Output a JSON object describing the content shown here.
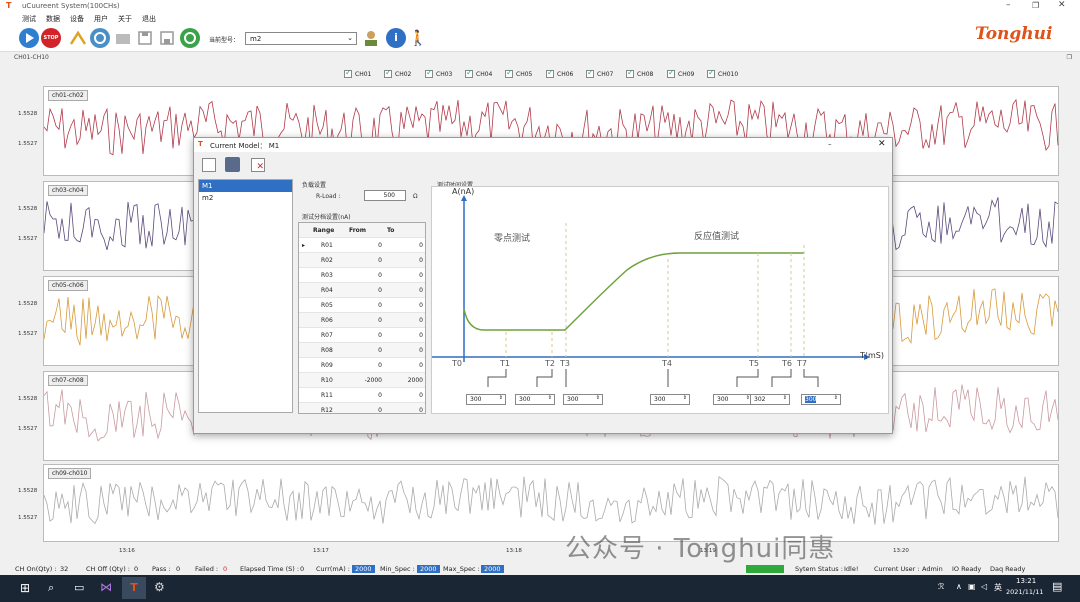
{
  "window": {
    "title": "uCuureent System(100CHs)"
  },
  "menu": [
    "测试",
    "数据",
    "设备",
    "用户",
    "关于",
    "退出"
  ],
  "toolbar": {
    "model_label": "当前型号：",
    "model_value": "m2",
    "stop_label": "STOP"
  },
  "brand": "Tonghui",
  "main_header": "CH01-CH10",
  "channels": [
    "CH01",
    "CH02",
    "CH03",
    "CH04",
    "CH05",
    "CH06",
    "CH07",
    "CH08",
    "CH09",
    "CH010"
  ],
  "panels": [
    {
      "label": "ch01-ch02",
      "color": "#b03a4a",
      "y_ticks": [
        "1.5528",
        "1.5527"
      ]
    },
    {
      "label": "ch03-ch04",
      "color": "#5a4a7a",
      "y_ticks": [
        "1.5528",
        "1.5527"
      ]
    },
    {
      "label": "ch05-ch06",
      "color": "#d79a3a",
      "y_ticks": [
        "1.5528",
        "1.5527"
      ]
    },
    {
      "label": "ch07-ch08",
      "color": "#c89aa0",
      "y_ticks": [
        "1.5528",
        "1.5527"
      ]
    },
    {
      "label": "ch09-ch010",
      "color": "#aaaaaa",
      "y_ticks": [
        "1.5528",
        "1.5527"
      ]
    }
  ],
  "x_ticks": [
    "13:16",
    "13:17",
    "13:18",
    "13:19",
    "13:20"
  ],
  "dialog": {
    "title": "Current Model： M1",
    "models": [
      "M1",
      "m2"
    ],
    "load_group": "负载设置",
    "rload_label": "R-Load :",
    "rload_value": "500",
    "rload_unit": "Ω",
    "range_group": "测试分档设置(nA)",
    "table_headers": [
      "Range",
      "From",
      "To"
    ],
    "rows": [
      [
        "R01",
        "0",
        "0"
      ],
      [
        "R02",
        "0",
        "0"
      ],
      [
        "R03",
        "0",
        "0"
      ],
      [
        "R04",
        "0",
        "0"
      ],
      [
        "R05",
        "0",
        "0"
      ],
      [
        "R06",
        "0",
        "0"
      ],
      [
        "R07",
        "0",
        "0"
      ],
      [
        "R08",
        "0",
        "0"
      ],
      [
        "R09",
        "0",
        "0"
      ],
      [
        "R10",
        "-2000",
        "2000"
      ],
      [
        "R11",
        "0",
        "0"
      ],
      [
        "R12",
        "0",
        "0"
      ]
    ],
    "timing_group": "测试时间设置",
    "y_axis": "A(nA)",
    "x_axis": "T(mS)",
    "zero_label": "零点测试",
    "response_label": "反应值测试",
    "t_labels": [
      "T0",
      "T1",
      "T2",
      "T3",
      "T4",
      "T5",
      "T6",
      "T7"
    ],
    "spins": [
      "300",
      "300",
      "300",
      "300",
      "300",
      "302",
      "300"
    ]
  },
  "status": {
    "ch_on": "CH On(Qty) :",
    "ch_on_v": "32",
    "ch_off": "CH Off (Qty) :",
    "ch_off_v": "0",
    "pass": "Pass :",
    "pass_v": "0",
    "failed": "Failed :",
    "failed_v": "0",
    "elapsed": "Elapsed Time (S) :",
    "elapsed_v": "0",
    "curr": "Curr(mA) :",
    "curr_v": "2000",
    "min": "Min_Spec :",
    "min_v": "2000",
    "max": "Max_Spec :",
    "max_v": "2000",
    "sys": "Sytem Status :",
    "sys_v": "Idle!",
    "user": "Current User :",
    "user_v": "Admin",
    "io": "IO Ready",
    "daq": "Daq Ready"
  },
  "taskbar": {
    "time": "13:21",
    "date": "2021/11/11",
    "ime": "英"
  },
  "watermark": "公众号 · Tonghui同惠"
}
